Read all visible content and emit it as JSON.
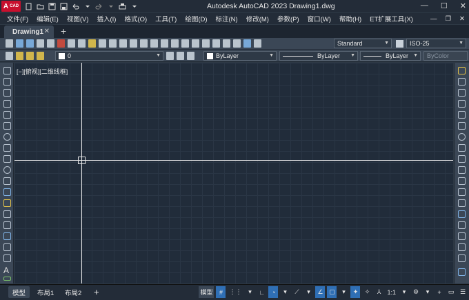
{
  "app": {
    "logo_text": "A",
    "logo_sub": "CAD",
    "title": "Autodesk AutoCAD 2023    Drawing1.dwg",
    "window_controls": {
      "minimize": "—",
      "maximize": "☐",
      "close": "✕"
    }
  },
  "menu": [
    "文件(F)",
    "编辑(E)",
    "视图(V)",
    "插入(I)",
    "格式(O)",
    "工具(T)",
    "绘图(D)",
    "标注(N)",
    "修改(M)",
    "参数(P)",
    "窗口(W)",
    "帮助(H)",
    "ET扩展工具(X)"
  ],
  "tabs": {
    "active_tab": "Drawing1",
    "close": "✕",
    "add": "+"
  },
  "toolbar": {
    "text_style": "Standard",
    "dim_style": "ISO-25",
    "layer_name": "0",
    "color": "ByLayer",
    "linetype": "ByLayer",
    "lineweight": "ByLayer",
    "plot_style": "ByColor"
  },
  "viewport": {
    "label": "[−][俯视][二维线框]"
  },
  "status": {
    "layout_tabs": [
      "模型",
      "布局1",
      "布局2"
    ],
    "add_layout": "+",
    "model_label": "模型",
    "scale": "1:1"
  },
  "colors": {
    "accent": "#2f6fb5",
    "canvas": "#212c3a",
    "logo": "#c8102e"
  }
}
